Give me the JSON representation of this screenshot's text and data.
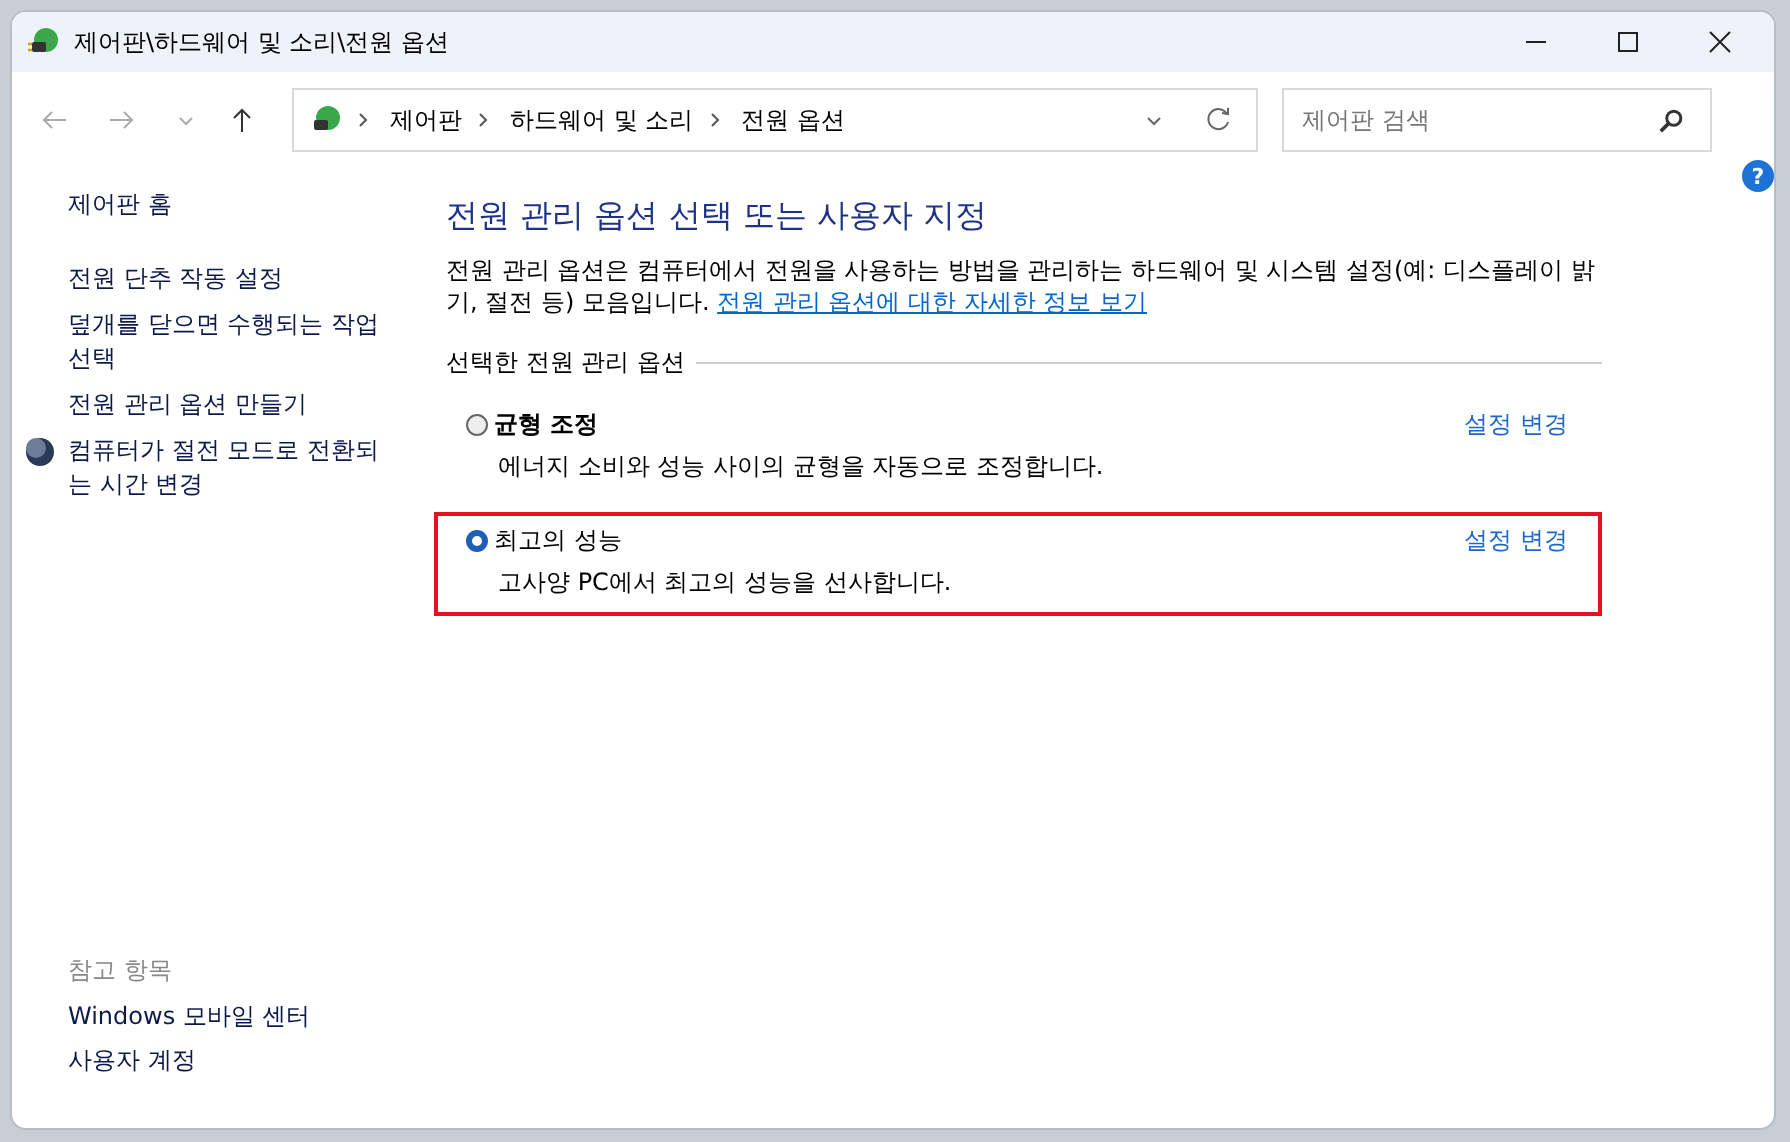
{
  "window": {
    "title": "제어판\\하드웨어 및 소리\\전원 옵션"
  },
  "breadcrumb": [
    "제어판",
    "하드웨어 및 소리",
    "전원 옵션"
  ],
  "search": {
    "placeholder": "제어판 검색"
  },
  "help": "?",
  "sidebar": {
    "home": "제어판 홈",
    "items": [
      {
        "label": "전원 단추 작동 설정",
        "kind": "plain"
      },
      {
        "label": "덮개를 닫으면 수행되는 작업 선택",
        "kind": "plain"
      },
      {
        "label": "전원 관리 옵션 만들기",
        "kind": "plain"
      },
      {
        "label": "컴퓨터가 절전 모드로 전환되는 시간 변경",
        "kind": "moon"
      }
    ],
    "see_also_title": "참고 항목",
    "see_also": [
      "Windows 모바일 센터",
      "사용자 계정"
    ]
  },
  "main": {
    "heading": "전원 관리 옵션 선택 또는 사용자 지정",
    "intro": "전원 관리 옵션은 컴퓨터에서 전원을 사용하는 방법을 관리하는 하드웨어 및 시스템 설정(예: 디스플레이 밝기, 절전 등) 모음입니다.",
    "intro_link": "전원 관리 옵션에 대한 자세한 정보 보기",
    "group_label": "선택한 전원 관리 옵션",
    "plans": [
      {
        "name": "균형 조정",
        "description": "에너지 소비와 성능 사이의 균형을 자동으로 조정합니다.",
        "link": "설정 변경",
        "selected": false,
        "highlighted": false
      },
      {
        "name": "최고의 성능",
        "description": "고사양 PC에서 최고의 성능을 선사합니다.",
        "link": "설정 변경",
        "selected": true,
        "highlighted": true
      }
    ]
  }
}
